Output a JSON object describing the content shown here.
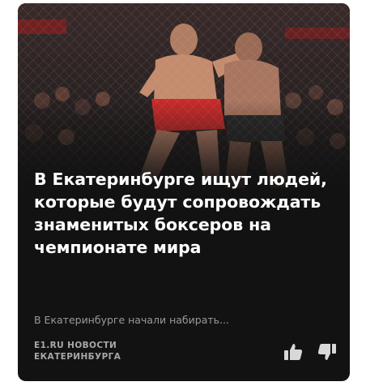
{
  "card": {
    "title": "В Екатеринбурге ищут людей, которые будут сопровождать знаменитых боксеров на чемпионате мира",
    "snippet": "В Екатеринбурге начали набирать...",
    "source_line1": "E1.RU НОВОСТИ",
    "source_line2": "ЕКАТЕРИНБУРГА",
    "image_icon": "photo-boxers-in-cage",
    "like_icon": "thumbs-up-icon",
    "dislike_icon": "thumbs-down-icon"
  },
  "colors": {
    "card_background": "#121212",
    "title": "#ffffff",
    "snippet": "#9a9a9a",
    "source": "#a8a8a8",
    "icons": "#d8d8d8"
  }
}
